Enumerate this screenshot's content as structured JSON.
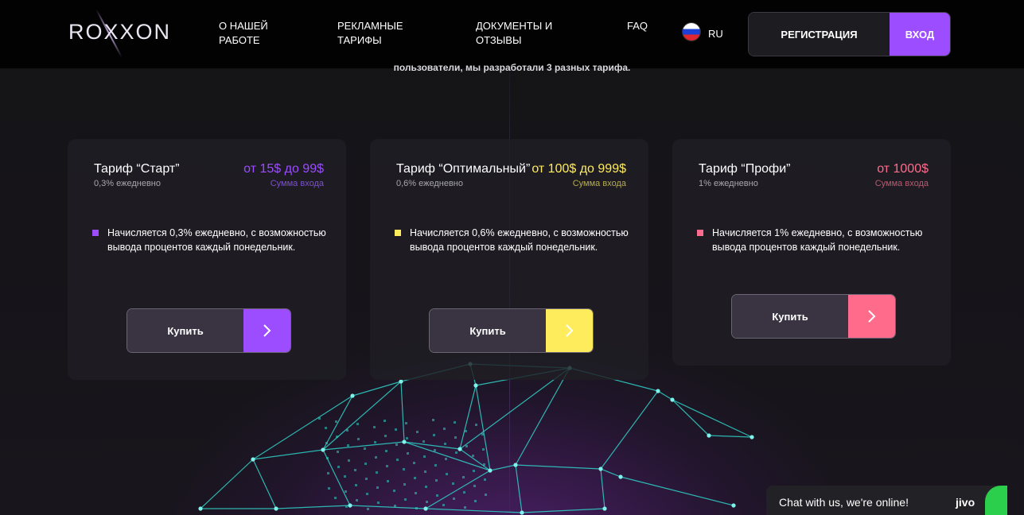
{
  "header": {
    "logo": "ROXXON",
    "nav": [
      {
        "label": "О НАШЕЙ\nРАБОТЕ"
      },
      {
        "label": "РЕКЛАМНЫЕ\nТАРИФЫ"
      },
      {
        "label": "ДОКУМЕНТЫ И\nОТЗЫВЫ"
      },
      {
        "label": "FAQ"
      }
    ],
    "language": "RU",
    "register_label": "РЕГИСТРАЦИЯ",
    "login_label": "ВХОД"
  },
  "intro_text": "пользователи, мы разработали 3 разных тарифа.",
  "plans": [
    {
      "name": "Тариф “Старт”",
      "rate": "0,3% ежедневно",
      "price": "от 15$ до 99$",
      "price_label": "Сумма входа",
      "description": "Начисляется 0,3% ежедневно, с возможностью вывода процентов каждый понедельник.",
      "buy_label": "Купить",
      "accent": "#9b4dff",
      "label_color": "#7c4fd0"
    },
    {
      "name": "Тариф “Оптимальный”",
      "rate": "0,6% ежедневно",
      "price": "от 100$ до 999$",
      "price_label": "Сумма входа",
      "description": "Начисляется 0,6% ежедневно, с возможностью вывода процентов каждый понедельник.",
      "buy_label": "Купить",
      "accent": "#ffec5c",
      "label_color": "#b8ab4c"
    },
    {
      "name": "Тариф “Профи”",
      "rate": "1% ежедневно",
      "price": "от 1000$",
      "price_label": "Сумма входа",
      "description": "Начисляется 1% ежедневно, с возможностью вывода процентов каждый понедельник.",
      "buy_label": "Купить",
      "accent": "#ff6b8b",
      "label_color": "#b85a70"
    }
  ],
  "chat": {
    "text": "Chat with us, we're online!",
    "brand": "jivo"
  },
  "colors": {
    "network": "#2fd3c9",
    "background": "#141416"
  }
}
